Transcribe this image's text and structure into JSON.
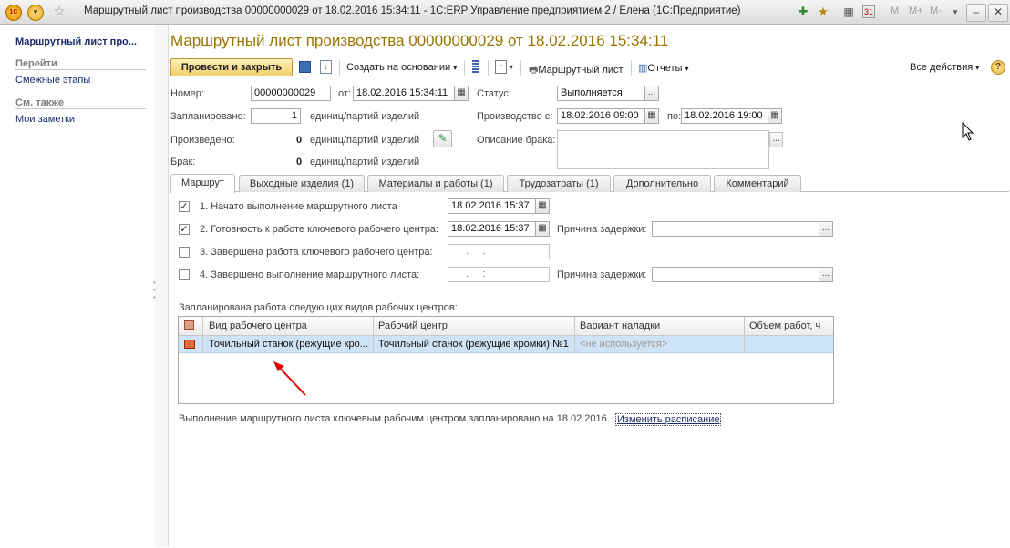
{
  "window": {
    "title": "Маршрутный лист производства 00000000029 от 18.02.2016 15:34:11 - 1С:ERP Управление предприятием 2 / Елена  (1С:Предприятие)",
    "memory_buttons": [
      "M",
      "M+",
      "M-"
    ]
  },
  "left_panel": {
    "title": "Маршрутный лист про...",
    "goto_header": "Перейти",
    "goto_items": [
      "Смежные этапы"
    ],
    "see_also_header": "См. также",
    "see_also_items": [
      "Мои заметки"
    ]
  },
  "document": {
    "title": "Маршрутный лист производства 00000000029 от 18.02.2016 15:34:11"
  },
  "toolbar": {
    "post_close": "Провести и закрыть",
    "create_based": "Создать на основании",
    "route_sheet": "Маршрутный лист",
    "reports": "Отчеты",
    "all_actions": "Все действия"
  },
  "header": {
    "number_label": "Номер:",
    "number": "00000000029",
    "from_label": "от:",
    "from_date": "18.02.2016 15:34:11",
    "status_label": "Статус:",
    "status": "Выполняется",
    "planned_label": "Запланировано:",
    "planned_value": "1",
    "unit": "единиц/партий изделий",
    "production_label": "Производство с:",
    "production_from": "18.02.2016 09:00",
    "to_label": "по:",
    "production_to": "18.02.2016 19:00",
    "produced_label": "Произведено:",
    "produced_value": "0",
    "defect_label": "Брак:",
    "defect_value": "0",
    "defect_desc_label": "Описание брака:"
  },
  "tabs": [
    {
      "label": "Маршрут",
      "active": true
    },
    {
      "label": "Выходные изделия (1)"
    },
    {
      "label": "Материалы и работы (1)"
    },
    {
      "label": "Трудозатраты (1)"
    },
    {
      "label": "Дополнительно"
    },
    {
      "label": "Комментарий"
    }
  ],
  "route": {
    "steps": [
      {
        "label": "1. Начато выполнение маршрутного листа",
        "checked": true,
        "date": "18.02.2016 15:37"
      },
      {
        "label": "2. Готовность к работе ключевого рабочего центра:",
        "checked": true,
        "date": "18.02.2016 15:37"
      },
      {
        "label": "3. Завершена работа ключевого рабочего центра:",
        "checked": false,
        "date": ".  .     :"
      },
      {
        "label": "4. Завершено выполнение маршрутного листа:",
        "checked": false,
        "date": ".  .     :"
      }
    ],
    "delay_label": "Причина задержки:",
    "planned_work_label": "Запланирована работа следующих видов рабочих центров:",
    "table": {
      "columns": [
        "Вид рабочего центра",
        "Рабочий центр",
        "Вариант наладки",
        "Объем работ, ч"
      ],
      "rows": [
        [
          "Точильный станок (режущие кро...",
          "Точильный станок (режущие кромки) №1",
          "<не используется>",
          ""
        ]
      ]
    },
    "schedule_text": "Выполнение маршрутного листа ключевым рабочим центром запланировано на 18.02.2016.",
    "change_schedule": "Изменить расписание"
  },
  "colors": {
    "title": "#9b7400",
    "primary_button": "#f0cf6a",
    "selected_row": "#cfe3f6",
    "nav_link": "#1a2a6c",
    "arrow": "#e00000"
  }
}
